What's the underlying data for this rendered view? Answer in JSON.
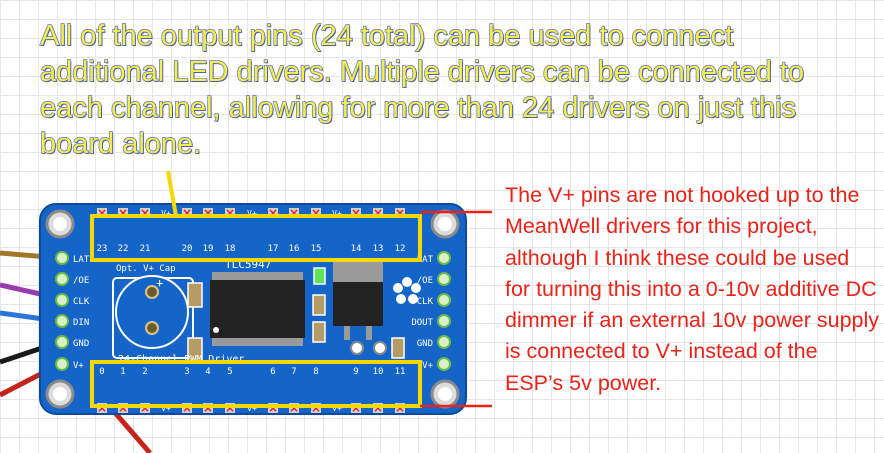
{
  "annotations": {
    "top_note": "All of the output pins (24 total) can be used to connect additional LED drivers.  Multiple drivers can be connected to each channel, allowing for more than 24 drivers on just this board alone.",
    "right_note": "The V+ pins are not hooked up to the MeanWell drivers for this project, although I think these could be used for turning this into a 0-10v additive DC dimmer if an external 10v power supply is connected to V+ instead of the ESP’s 5v power."
  },
  "board": {
    "chip_label": "TLC5947",
    "cap_label": "Opt. V+ Cap",
    "board_title": "24-Channel PWM Driver",
    "top_channels": [
      "23",
      "22",
      "21",
      "20",
      "19",
      "18",
      "17",
      "16",
      "15",
      "14",
      "13",
      "12"
    ],
    "bottom_channels": [
      "0",
      "1",
      "2",
      "3",
      "4",
      "5",
      "6",
      "7",
      "8",
      "9",
      "10",
      "11"
    ],
    "left_pins": [
      "LAT",
      "/OE",
      "CLK",
      "DIN",
      "GND",
      "V+"
    ],
    "right_pins": [
      "LAT",
      "/OE",
      "CLK",
      "DOUT",
      "GND",
      "V+"
    ],
    "vplus_label": "V+",
    "plus_sign": "+"
  },
  "colors": {
    "board": "#1565c8",
    "highlight_box": "#f5d800",
    "note_yellow": "#f4ef4a",
    "note_red": "#e8231a"
  }
}
